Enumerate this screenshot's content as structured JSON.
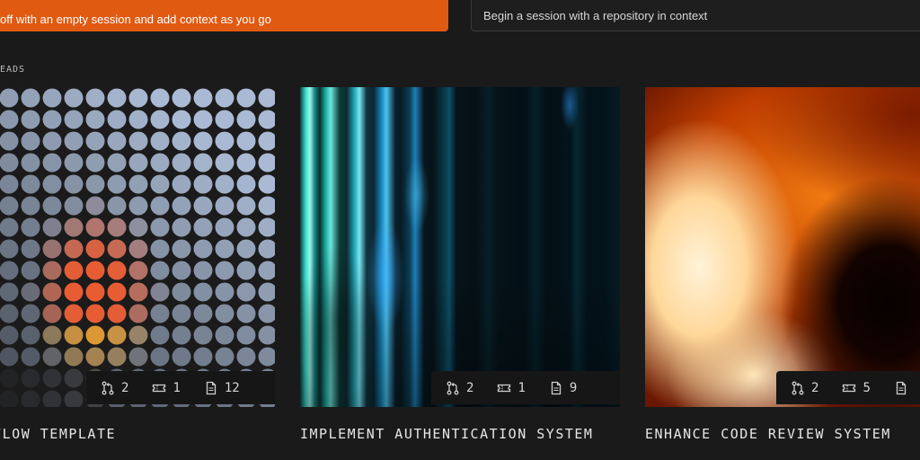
{
  "actions": {
    "primary": {
      "description": "off with an empty session and add context as you go"
    },
    "secondary": {
      "description": "Begin a session with a repository in context"
    }
  },
  "section": {
    "label": "EADS"
  },
  "cards": [
    {
      "title": "WORKFLOW TEMPLATE",
      "stats": {
        "pull_requests": "2",
        "tickets": "1",
        "files": "12"
      }
    },
    {
      "title": "IMPLEMENT AUTHENTICATION SYSTEM",
      "stats": {
        "pull_requests": "2",
        "tickets": "1",
        "files": "9"
      }
    },
    {
      "title": "ENHANCE CODE REVIEW SYSTEM",
      "stats": {
        "pull_requests": "2",
        "tickets": "5",
        "files": ""
      }
    }
  ],
  "icons": {
    "pull_request": "git-pull-request-icon",
    "ticket": "ticket-icon",
    "file": "file-icon"
  },
  "colors": {
    "background": "#1a1a1a",
    "accent": "#e05a12",
    "panel": "#161616",
    "text": "#e6e6e6"
  }
}
